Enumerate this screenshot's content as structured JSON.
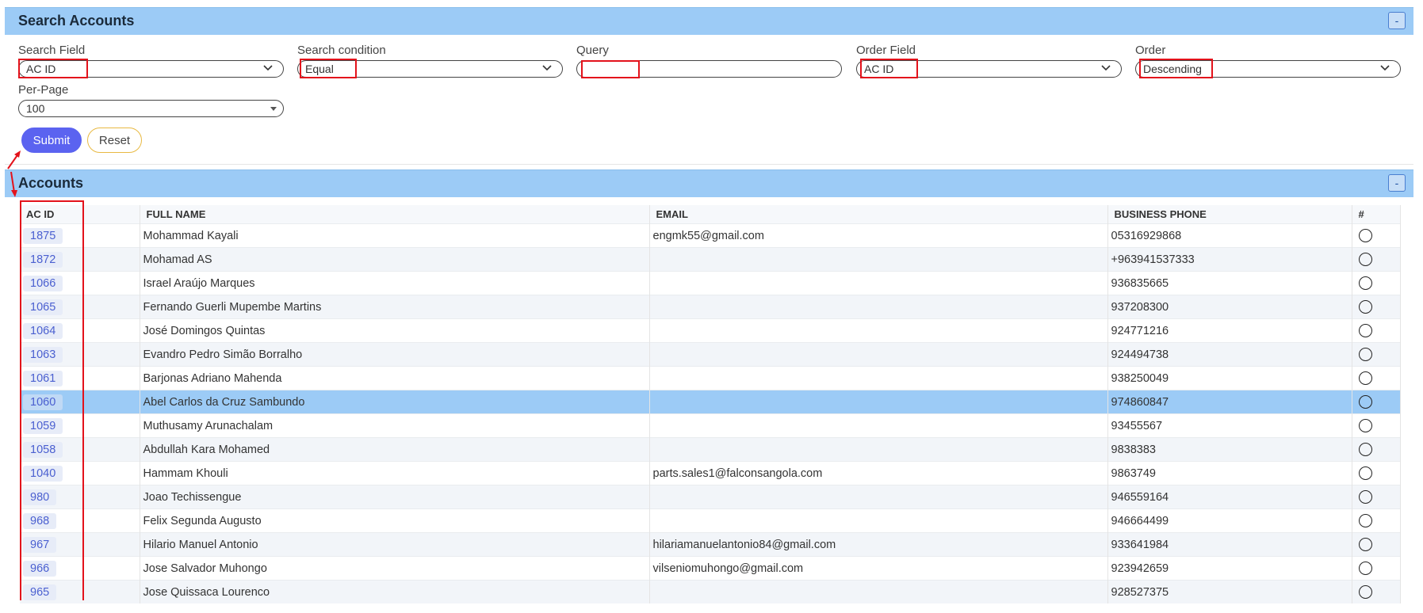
{
  "search": {
    "title": "Search Accounts",
    "collapse_label": "-",
    "fields": {
      "search_field": {
        "label": "Search Field",
        "value": "AC ID"
      },
      "search_condition": {
        "label": "Search condition",
        "value": "Equal"
      },
      "query": {
        "label": "Query",
        "value": ""
      },
      "order_field": {
        "label": "Order Field",
        "value": "AC ID"
      },
      "order": {
        "label": "Order",
        "value": "Descending"
      },
      "per_page": {
        "label": "Per-Page",
        "value": "100"
      }
    },
    "submit_label": "Submit",
    "reset_label": "Reset"
  },
  "accounts": {
    "title": "Accounts",
    "collapse_label": "-",
    "columns": [
      "AC ID",
      "FULL NAME",
      "EMAIL",
      "BUSINESS PHONE",
      "#"
    ],
    "rows": [
      {
        "id": "1875",
        "name": "Mohammad Kayali",
        "email": "engmk55@gmail.com",
        "phone": "05316929868"
      },
      {
        "id": "1872",
        "name": "Mohamad AS",
        "email": "",
        "phone": "+963941537333"
      },
      {
        "id": "1066",
        "name": "Israel Araújo Marques",
        "email": "",
        "phone": "936835665"
      },
      {
        "id": "1065",
        "name": "Fernando Guerli Mupembe Martins",
        "email": "",
        "phone": "937208300"
      },
      {
        "id": "1064",
        "name": "José Domingos Quintas",
        "email": "",
        "phone": "924771216"
      },
      {
        "id": "1063",
        "name": "Evandro Pedro Simão Borralho",
        "email": "",
        "phone": "924494738"
      },
      {
        "id": "1061",
        "name": "Barjonas Adriano Mahenda",
        "email": "",
        "phone": "938250049"
      },
      {
        "id": "1060",
        "name": "Abel Carlos da Cruz Sambundo",
        "email": "",
        "phone": "974860847"
      },
      {
        "id": "1059",
        "name": "Muthusamy Arunachalam",
        "email": "",
        "phone": "93455567"
      },
      {
        "id": "1058",
        "name": "Abdullah Kara Mohamed",
        "email": "",
        "phone": "9838383"
      },
      {
        "id": "1040",
        "name": "Hammam Khouli",
        "email": "parts.sales1@falconsangola.com",
        "phone": "9863749"
      },
      {
        "id": "980",
        "name": "Joao Techissengue",
        "email": "",
        "phone": "946559164"
      },
      {
        "id": "968",
        "name": "Felix Segunda Augusto",
        "email": "",
        "phone": "946664499"
      },
      {
        "id": "967",
        "name": "Hilario Manuel Antonio",
        "email": "hilariamanuelantonio84@gmail.com",
        "phone": "933641984"
      },
      {
        "id": "966",
        "name": "Jose Salvador Muhongo",
        "email": "vilseniomuhongo@gmail.com",
        "phone": "923942659"
      },
      {
        "id": "965",
        "name": "Jose Quissaca Lourenco",
        "email": "",
        "phone": "928527375"
      }
    ],
    "selected_id": "1060"
  },
  "colors": {
    "header_bg": "#9ccbf6",
    "submit_bg": "#5b63f0",
    "reset_border": "#e8b942",
    "highlight": "#e3121b",
    "selected_row": "#9ccbf6"
  },
  "icons": [
    "chevron-down-icon",
    "minus-icon",
    "radio-icon",
    "arrow-annotation-icon"
  ]
}
